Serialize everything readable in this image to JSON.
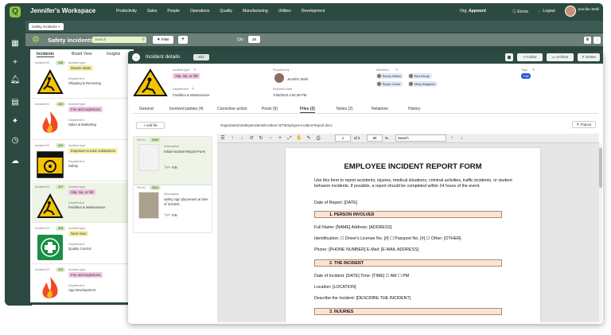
{
  "app": {
    "workspace_title": "Jennifer's Workspace",
    "menu": [
      "Productivity",
      "Sales",
      "People",
      "Operations",
      "Quality",
      "Manufacturing",
      "Utilities",
      "Development"
    ],
    "org_label": "Org:",
    "org_value": "Appword",
    "errors": "Errors",
    "logout": "Logout",
    "user_name": "Jennifer Stelli"
  },
  "tabs": {
    "chip": "Safety incidents ×"
  },
  "toolbar": {
    "title": "Safety incidents",
    "search_placeholder": "Search",
    "filter": "Filter",
    "plus": "+",
    "qty_label": "Qty:",
    "qty_value": "28"
  },
  "list_tabs": [
    "Incidents",
    "Board View",
    "Insights"
  ],
  "incidents": [
    {
      "id_label": "Incident ID",
      "id": "438",
      "type_label": "Incident type",
      "type": "Muscle strain",
      "dept_label": "Department",
      "dept": "Shipping & Receiving",
      "tag": "yel",
      "icon": "slip"
    },
    {
      "id_label": "Incident ID",
      "id": "430",
      "type_label": "Incident type",
      "type": "Fire and explosions",
      "dept_label": "Department",
      "dept": "Sales & Marketing",
      "tag": "pink",
      "icon": "fire"
    },
    {
      "id_label": "Incident ID",
      "id": "429",
      "type_label": "Incident type",
      "type": "Exposure to toxic substances",
      "dept_label": "Department",
      "dept": "Safety",
      "tag": "yel",
      "icon": "biohazard"
    },
    {
      "id_label": "Incident ID",
      "id": "427",
      "type_label": "Incident type",
      "type": "Slip, trip, or fall",
      "dept_label": "Department",
      "dept": "Facilities & Maintenance",
      "tag": "pink",
      "icon": "slip"
    },
    {
      "id_label": "Incident ID",
      "id": "425",
      "type_label": "Incident type",
      "type": "Near miss",
      "dept_label": "Department",
      "dept": "Quality Control",
      "tag": "yel",
      "icon": "firstaid"
    },
    {
      "id_label": "Incident ID",
      "id": "424",
      "type_label": "Incident type",
      "type": "Fire and explosions",
      "dept_label": "Department",
      "dept": "App Development",
      "tag": "pink",
      "icon": "fire"
    }
  ],
  "detail": {
    "title": "Incident details",
    "badge": "427",
    "buttons": [
      "Follow",
      "Archive",
      "Delete"
    ],
    "incident_type_label": "Incident type",
    "incident_type": "Slip, trip, or fall",
    "department_label": "Department",
    "department": "Facilities & Maintenance",
    "reported_by_label": "Reported by",
    "reported_by": "Jennifer Stelli",
    "reported_date_label": "Reported date",
    "reported_date": "7/30/2023 4:52:38 PM",
    "members_label": "Members",
    "members": [
      "Becky Wates",
      "Ben Brody",
      "Bryan Jones",
      "Mary Abgarian"
    ],
    "tags_label": "Tags",
    "tag": "Fall",
    "tabs": [
      "General",
      "Involved parties (4)",
      "Corrective action",
      "Posts (9)",
      "Files (2)",
      "Notes (2)",
      "Relations",
      "History"
    ],
    "add_file": "+ Add file",
    "path": "Organization\\SafetyIncidents\\Incident 427\\Employee-incident-Report.docx",
    "popout": "Popout",
    "files": [
      {
        "id_label": "File ID",
        "id": "2540",
        "desc_label": "Description",
        "desc": "Initial-Incident-Report-Form",
        "type_label": "Type",
        "type": "File"
      },
      {
        "id_label": "File ID",
        "id": "2541",
        "desc_label": "Description",
        "desc": "safety sign placement at time of incident",
        "type_label": "Type",
        "type": "File"
      }
    ],
    "viewer": {
      "page": "1",
      "of": "of 2",
      "zoom": "90",
      "pct": "%",
      "search_placeholder": "Search"
    }
  },
  "doc": {
    "title": "EMPLOYEE INCIDENT REPORT FORM",
    "intro": "Use this form to report accidents, injuries, medical situations, criminal activities, traffic incidents, or student behavior incidents. If possible, a report should be completed within 24 hours of the event.",
    "date_of_report": "Date of Report: [DATE]",
    "sec1": "1.   PERSON INVOLVED",
    "full_name": "Full Name: [NAME] Address: [ADDRESS]",
    "identification": "Identification: ☐ Driver's License No. [#] ☐ Passport No. [#] ☐ Other: [OTHER]",
    "phone": "Phone: [PHONE NUMBER] E-Mail: [E-MAIL ADDRESS]",
    "sec2": "2.   THE INCIDENT",
    "date_of_incident": "Date of Incident: [DATE] Time: [TIME] ☐ AM ☐ PM",
    "location": "Location: [LOCATION]",
    "describe": "Describe the Incident: [DESCRIBE THE INCIDENT]",
    "sec3": "3.   INJURIES"
  }
}
